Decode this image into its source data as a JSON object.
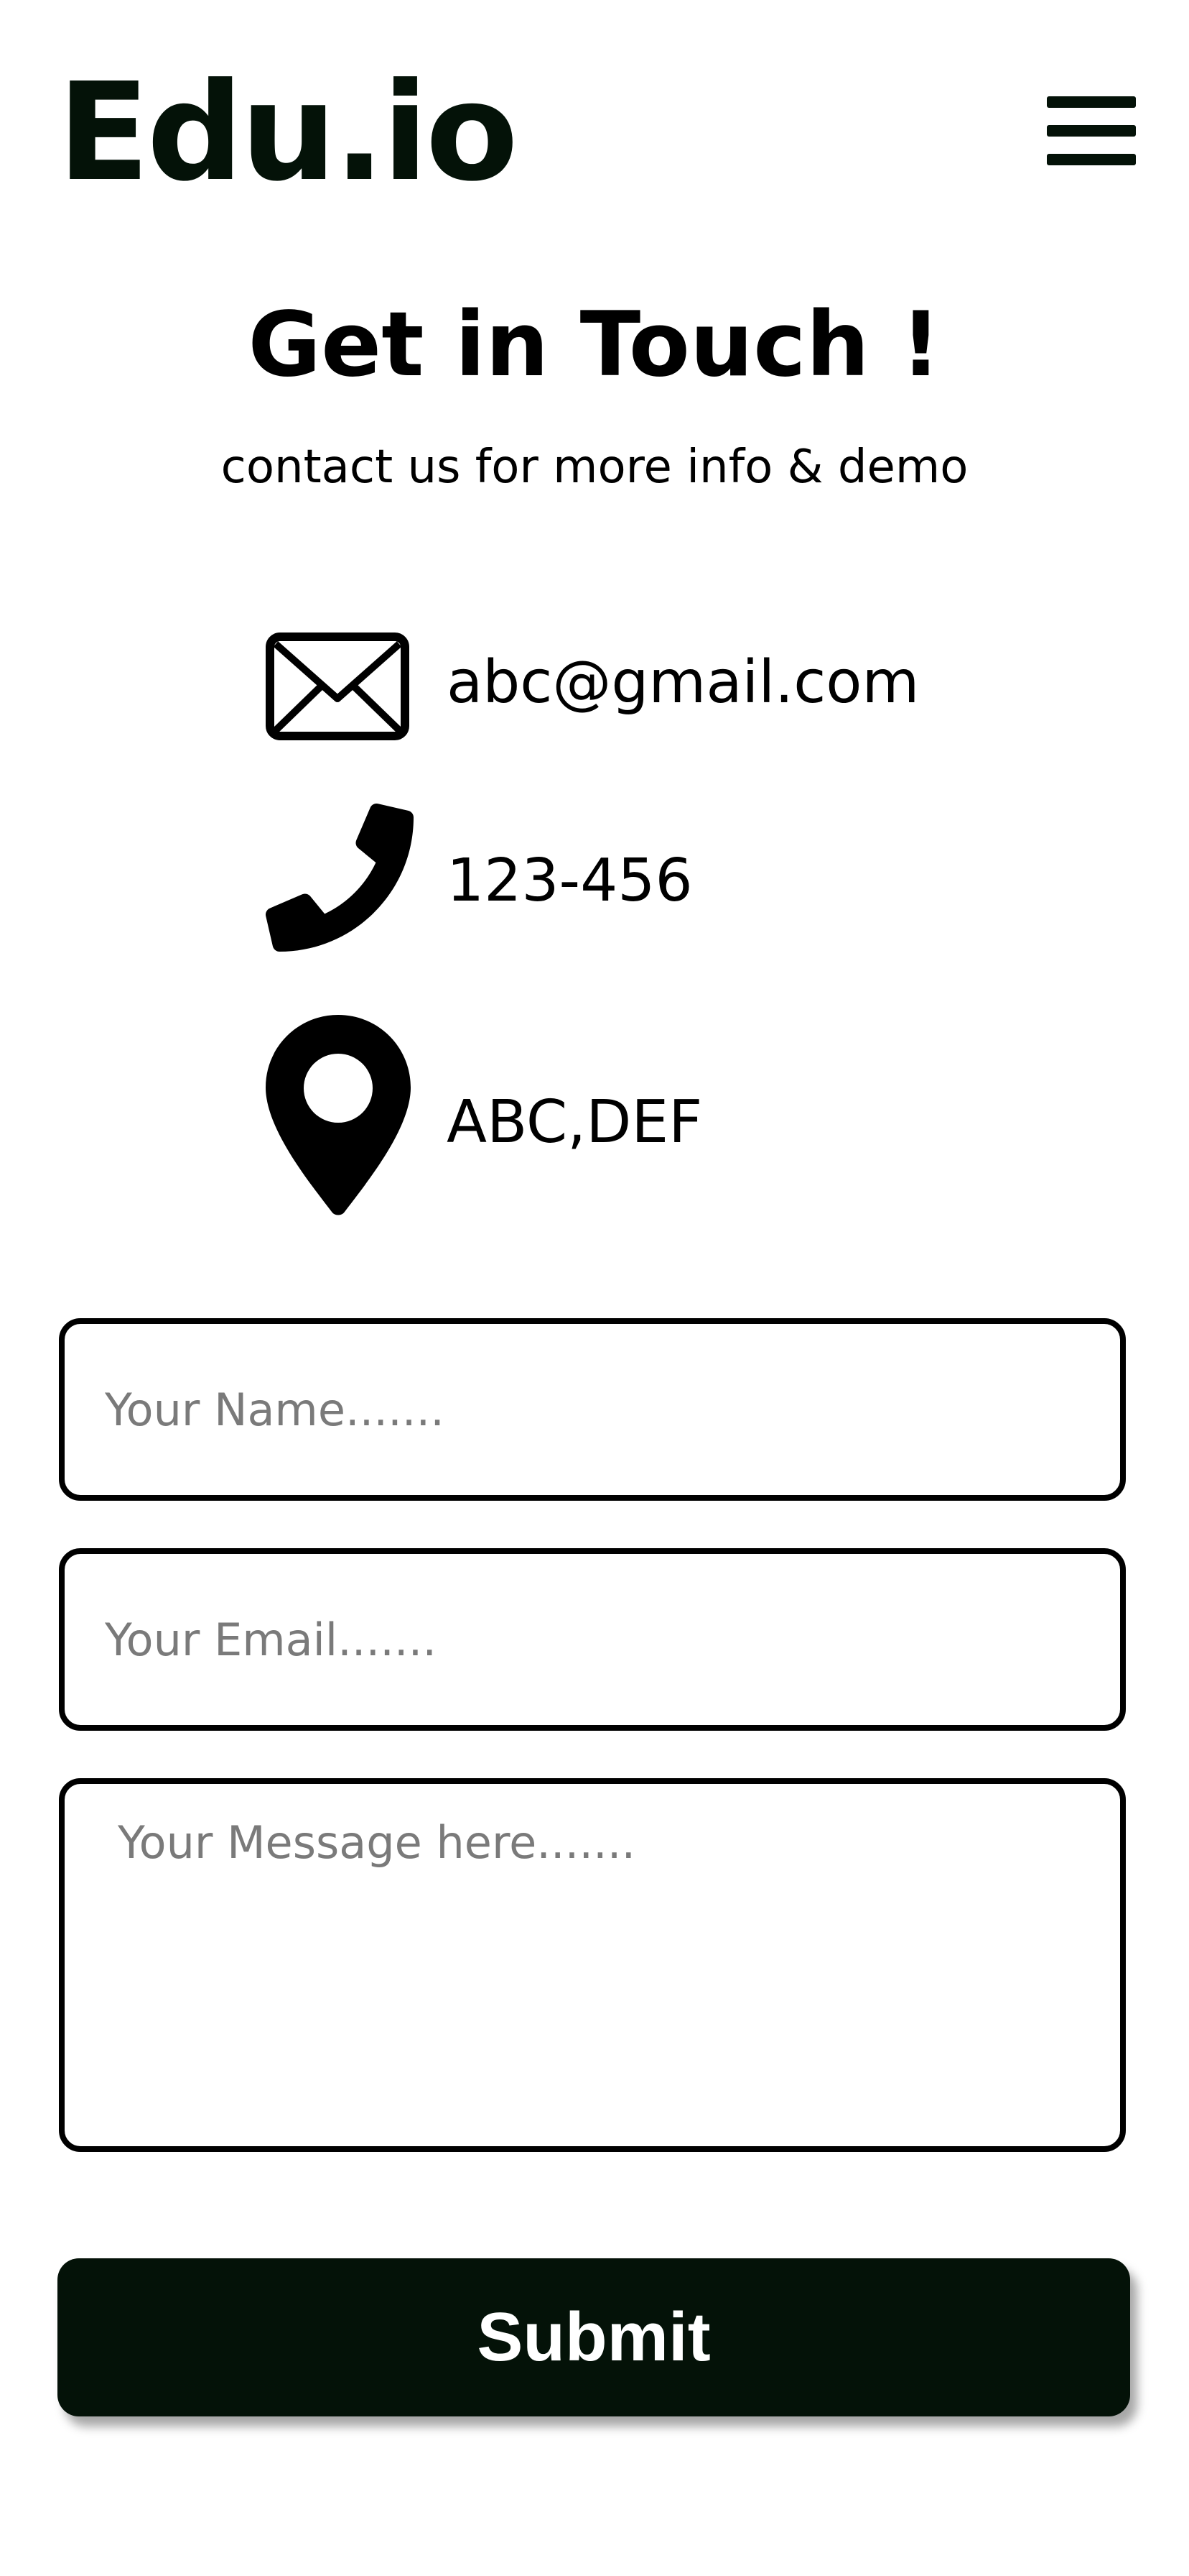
{
  "header": {
    "logo": "Edu.io",
    "menu_icon": "hamburger-menu-icon"
  },
  "hero": {
    "title": "Get in Touch !",
    "subtitle": "contact us for more info & demo"
  },
  "contact": {
    "email": {
      "icon": "envelope-icon",
      "text": "abc@gmail.com"
    },
    "phone": {
      "icon": "phone-icon",
      "text": "123-456"
    },
    "address": {
      "icon": "map-pin-icon",
      "text": "ABC,DEF"
    }
  },
  "form": {
    "name_placeholder": "Your Name.......",
    "email_placeholder": "Your Email.......",
    "message_placeholder": "Your Message here.......",
    "submit_label": "Submit"
  },
  "colors": {
    "brand_dark": "#041208",
    "text": "#000000",
    "placeholder": "#7a7a7a",
    "background": "#ffffff"
  }
}
